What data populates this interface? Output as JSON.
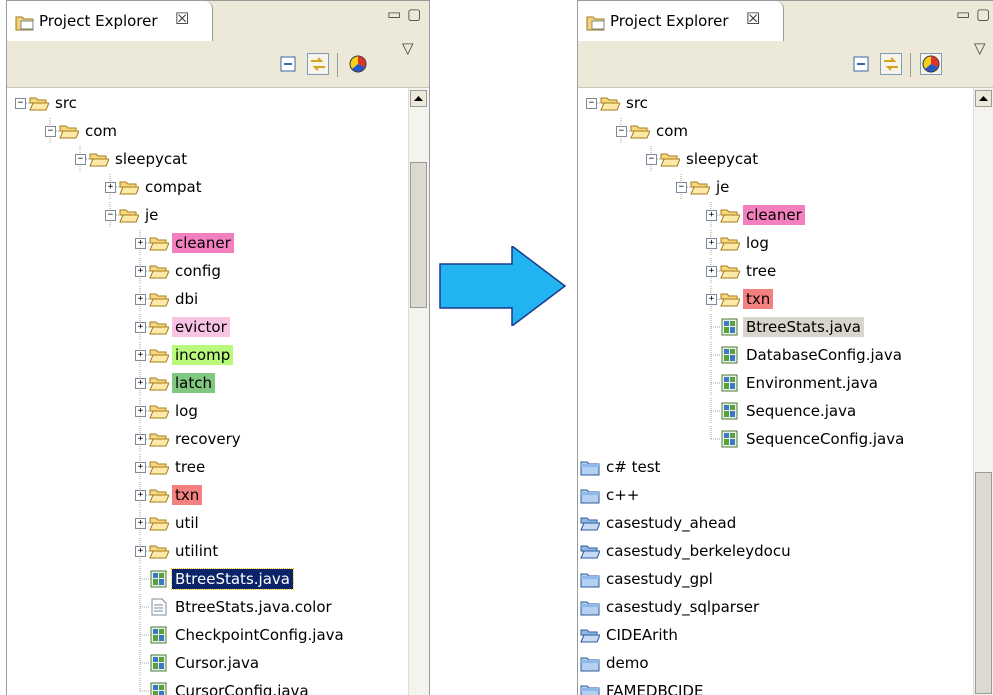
{
  "colors": {
    "cleaner": "#f47fbf",
    "evictor": "#f9c3e4",
    "incomp": "#b9f97c",
    "latch": "#80c880",
    "txn": "#f58080",
    "selected_dark": "#0a246a",
    "selected_gray": "#d8d5cc",
    "arrow": "#21b4f0"
  },
  "left": {
    "title": "Project Explorer",
    "close_glyph": "☒",
    "minimize_glyph": "▭",
    "maximize_glyph": "▢",
    "menu_glyph": "▽",
    "tree": [
      {
        "label": "src",
        "depth": 0,
        "kind": "folder",
        "exp": "−"
      },
      {
        "label": "com",
        "depth": 1,
        "kind": "folder",
        "exp": "−"
      },
      {
        "label": "sleepycat",
        "depth": 2,
        "kind": "folder",
        "exp": "−"
      },
      {
        "label": "compat",
        "depth": 3,
        "kind": "folder",
        "exp": "+"
      },
      {
        "label": "je",
        "depth": 3,
        "kind": "folder",
        "exp": "−"
      },
      {
        "label": "cleaner",
        "depth": 4,
        "kind": "folder",
        "exp": "+",
        "hl": "cleaner"
      },
      {
        "label": "config",
        "depth": 4,
        "kind": "folder",
        "exp": "+"
      },
      {
        "label": "dbi",
        "depth": 4,
        "kind": "folder",
        "exp": "+"
      },
      {
        "label": "evictor",
        "depth": 4,
        "kind": "folder",
        "exp": "+",
        "hl": "evictor"
      },
      {
        "label": "incomp",
        "depth": 4,
        "kind": "folder",
        "exp": "+",
        "hl": "incomp"
      },
      {
        "label": "latch",
        "depth": 4,
        "kind": "folder",
        "exp": "+",
        "hl": "latch"
      },
      {
        "label": "log",
        "depth": 4,
        "kind": "folder",
        "exp": "+"
      },
      {
        "label": "recovery",
        "depth": 4,
        "kind": "folder",
        "exp": "+"
      },
      {
        "label": "tree",
        "depth": 4,
        "kind": "folder",
        "exp": "+"
      },
      {
        "label": "txn",
        "depth": 4,
        "kind": "folder",
        "exp": "+",
        "hl": "txn"
      },
      {
        "label": "util",
        "depth": 4,
        "kind": "folder",
        "exp": "+"
      },
      {
        "label": "utilint",
        "depth": 4,
        "kind": "folder",
        "exp": "+"
      },
      {
        "label": "BtreeStats.java",
        "depth": 4,
        "kind": "java",
        "sel": "dark"
      },
      {
        "label": "BtreeStats.java.color",
        "depth": 4,
        "kind": "text"
      },
      {
        "label": "CheckpointConfig.java",
        "depth": 4,
        "kind": "java"
      },
      {
        "label": "Cursor.java",
        "depth": 4,
        "kind": "java"
      },
      {
        "label": "CursorConfig.java",
        "depth": 4,
        "kind": "java"
      }
    ]
  },
  "right": {
    "title": "Project Explorer",
    "close_glyph": "☒",
    "minimize_glyph": "▭",
    "maximize_glyph": "▢",
    "menu_glyph": "▽",
    "tree": [
      {
        "label": "src",
        "depth": 0,
        "kind": "folder",
        "exp": "−"
      },
      {
        "label": "com",
        "depth": 1,
        "kind": "folder",
        "exp": "−"
      },
      {
        "label": "sleepycat",
        "depth": 2,
        "kind": "folder",
        "exp": "−"
      },
      {
        "label": "je",
        "depth": 3,
        "kind": "folder",
        "exp": "−"
      },
      {
        "label": "cleaner",
        "depth": 4,
        "kind": "folder",
        "exp": "+",
        "hl": "cleaner"
      },
      {
        "label": "log",
        "depth": 4,
        "kind": "folder",
        "exp": "+"
      },
      {
        "label": "tree",
        "depth": 4,
        "kind": "folder",
        "exp": "+"
      },
      {
        "label": "txn",
        "depth": 4,
        "kind": "folder",
        "exp": "+",
        "hl": "txn"
      },
      {
        "label": "BtreeStats.java",
        "depth": 4,
        "kind": "java",
        "sel": "gray"
      },
      {
        "label": "DatabaseConfig.java",
        "depth": 4,
        "kind": "java"
      },
      {
        "label": "Environment.java",
        "depth": 4,
        "kind": "java"
      },
      {
        "label": "Sequence.java",
        "depth": 4,
        "kind": "java"
      },
      {
        "label": "SequenceConfig.java",
        "depth": 4,
        "kind": "java"
      },
      {
        "label": "c# test",
        "depth": -1,
        "kind": "project"
      },
      {
        "label": "c++",
        "depth": -1,
        "kind": "project"
      },
      {
        "label": "casestudy_ahead",
        "depth": -1,
        "kind": "project-open"
      },
      {
        "label": "casestudy_berkeleydocu",
        "depth": -1,
        "kind": "project-open"
      },
      {
        "label": "casestudy_gpl",
        "depth": -1,
        "kind": "project"
      },
      {
        "label": "casestudy_sqlparser",
        "depth": -1,
        "kind": "project"
      },
      {
        "label": "CIDEArith",
        "depth": -1,
        "kind": "project-open"
      },
      {
        "label": "demo",
        "depth": -1,
        "kind": "project"
      },
      {
        "label": "FAMEDBCIDE",
        "depth": -1,
        "kind": "project"
      }
    ]
  },
  "scroll": {
    "left_thumb_top_fraction": 0.09,
    "left_thumb_size_fraction": 0.25,
    "right_thumb_top_fraction": 0.62,
    "right_thumb_size_fraction": 0.38
  }
}
